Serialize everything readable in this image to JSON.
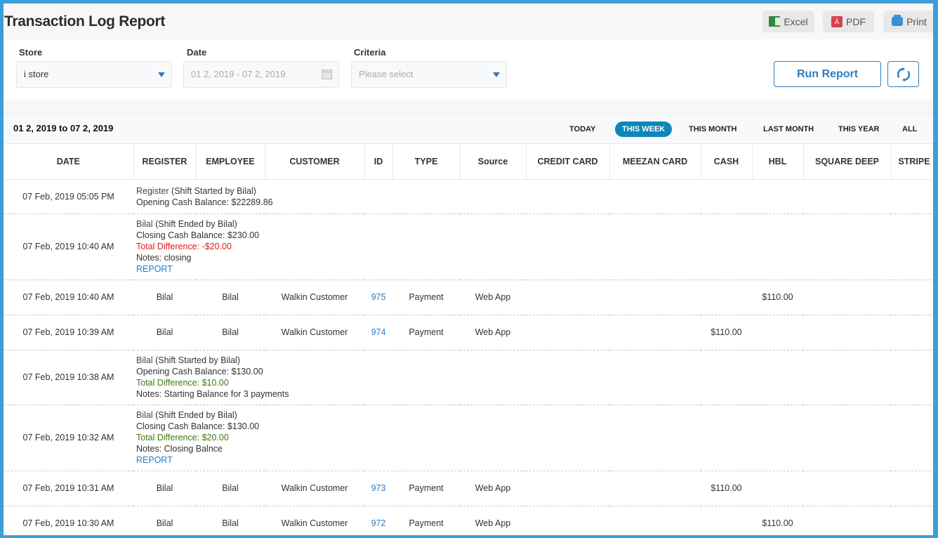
{
  "header": {
    "title": "Transaction Log Report",
    "export": [
      {
        "label": "Excel",
        "icon": "excel-icon"
      },
      {
        "label": "PDF",
        "icon": "pdf-icon"
      },
      {
        "label": "Print",
        "icon": "print-icon"
      }
    ]
  },
  "filters": {
    "store": {
      "label": "Store",
      "value": "i store"
    },
    "date": {
      "label": "Date",
      "value": "01 2, 2019 - 07 2, 2019"
    },
    "criteria": {
      "label": "Criteria",
      "placeholder": "Please select"
    },
    "run_label": "Run Report"
  },
  "report": {
    "range_title": "01 2, 2019 to 07 2, 2019",
    "periods": [
      "TODAY",
      "THIS WEEK",
      "THIS MONTH",
      "LAST MONTH",
      "THIS YEAR",
      "ALL"
    ],
    "active_period": "THIS WEEK",
    "columns": [
      "DATE",
      "REGISTER",
      "EMPLOYEE",
      "CUSTOMER",
      "ID",
      "TYPE",
      "Source",
      "CREDIT CARD",
      "MEEZAN CARD",
      "CASH",
      "HBL",
      "SQUARE DEEP",
      "STRIPE"
    ],
    "rows": [
      {
        "kind": "shift",
        "date": "07 Feb, 2019 05:05 PM",
        "name": "Register",
        "event": "(Shift Started by Bilal)",
        "balance": "Opening Cash Balance: $22289.86"
      },
      {
        "kind": "shift",
        "date": "07 Feb, 2019 10:40 AM",
        "name": "Bilal",
        "event": "(Shift Ended by Bilal)",
        "balance": "Closing Cash Balance: $230.00",
        "difference": "Total Difference: -$20.00",
        "difference_status": "negative",
        "notes": "Notes: closing",
        "report_link": "REPORT"
      },
      {
        "kind": "payment",
        "date": "07 Feb, 2019 10:40 AM",
        "register": "Bilal",
        "employee": "Bilal",
        "customer": "Walkin Customer",
        "id": "975",
        "type": "Payment",
        "source": "Web App",
        "credit_card": "",
        "meezan_card": "",
        "cash": "",
        "hbl": "$110.00",
        "square_deep": "",
        "stripe": ""
      },
      {
        "kind": "payment",
        "date": "07 Feb, 2019 10:39 AM",
        "register": "Bilal",
        "employee": "Bilal",
        "customer": "Walkin Customer",
        "id": "974",
        "type": "Payment",
        "source": "Web App",
        "credit_card": "",
        "meezan_card": "",
        "cash": "$110.00",
        "hbl": "",
        "square_deep": "",
        "stripe": ""
      },
      {
        "kind": "shift",
        "date": "07 Feb, 2019 10:38 AM",
        "name": "Bilal",
        "event": "(Shift Started by Bilal)",
        "balance": "Opening Cash Balance: $130.00",
        "difference": "Total Difference: $10.00",
        "difference_status": "positive",
        "notes": "Notes: Starting Balance for 3 payments"
      },
      {
        "kind": "shift",
        "date": "07 Feb, 2019 10:32 AM",
        "name": "Bilal",
        "event": "(Shift Ended by Bilal)",
        "balance": "Closing Cash Balance: $130.00",
        "difference": "Total Difference: $20.00",
        "difference_status": "positive",
        "notes": "Notes: Closing Balnce",
        "report_link": "REPORT"
      },
      {
        "kind": "payment",
        "date": "07 Feb, 2019 10:31 AM",
        "register": "Bilal",
        "employee": "Bilal",
        "customer": "Walkin Customer",
        "id": "973",
        "type": "Payment",
        "source": "Web App",
        "credit_card": "",
        "meezan_card": "",
        "cash": "$110.00",
        "hbl": "",
        "square_deep": "",
        "stripe": ""
      },
      {
        "kind": "payment",
        "date": "07 Feb, 2019 10:30 AM",
        "register": "Bilal",
        "employee": "Bilal",
        "customer": "Walkin Customer",
        "id": "972",
        "type": "Payment",
        "source": "Web App",
        "credit_card": "",
        "meezan_card": "",
        "cash": "",
        "hbl": "$110.00",
        "square_deep": "",
        "stripe": ""
      }
    ]
  },
  "colors": {
    "accent": "#2f7ebf",
    "active_period": "#0e86b8",
    "negative": "#e01b1b",
    "positive": "#3f7a10",
    "frame": "#3a9fd8"
  }
}
